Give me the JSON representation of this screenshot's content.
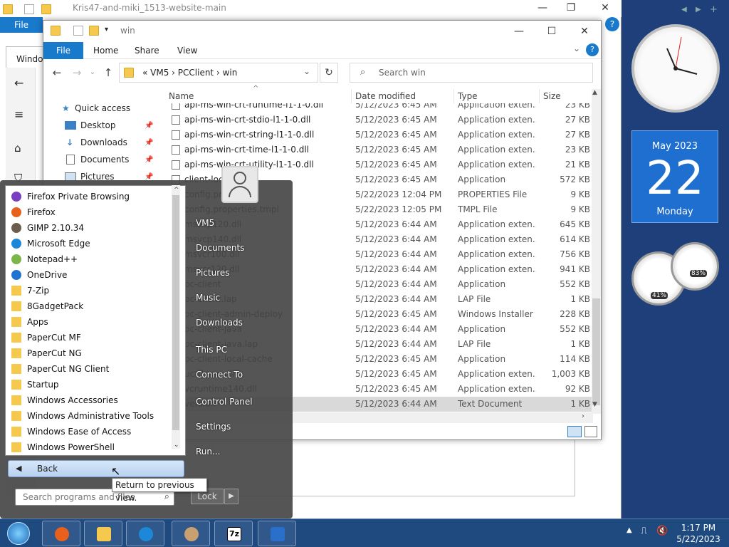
{
  "back_window": {
    "title": "Kris47-and-miki_1513-website-main",
    "file_tab": "File",
    "inner_title": "Windo"
  },
  "explorer": {
    "title": "win",
    "ribbon": {
      "file": "File",
      "home": "Home",
      "share": "Share",
      "view": "View"
    },
    "address": {
      "crumbs": "«   VM5   ›   PCClient   ›   win"
    },
    "search_placeholder": "Search win",
    "nav": [
      {
        "label": "Quick access",
        "pinned": false
      },
      {
        "label": "Desktop",
        "pinned": true
      },
      {
        "label": "Downloads",
        "pinned": true
      },
      {
        "label": "Documents",
        "pinned": true
      },
      {
        "label": "Pictures",
        "pinned": true
      }
    ],
    "columns": {
      "name": "Name",
      "date": "Date modified",
      "type": "Type",
      "size": "Size"
    },
    "files": [
      {
        "name": "api-ms-win-crt-runtime-l1-1-0.dll",
        "date": "5/12/2023 6:45 AM",
        "type": "Application exten...",
        "size": "23 KB"
      },
      {
        "name": "api-ms-win-crt-stdio-l1-1-0.dll",
        "date": "5/12/2023 6:45 AM",
        "type": "Application exten...",
        "size": "27 KB"
      },
      {
        "name": "api-ms-win-crt-string-l1-1-0.dll",
        "date": "5/12/2023 6:45 AM",
        "type": "Application exten...",
        "size": "27 KB"
      },
      {
        "name": "api-ms-win-crt-time-l1-1-0.dll",
        "date": "5/12/2023 6:45 AM",
        "type": "Application exten...",
        "size": "23 KB"
      },
      {
        "name": "api-ms-win-crt-utility-l1-1-0.dll",
        "date": "5/12/2023 6:45 AM",
        "type": "Application exten...",
        "size": "21 KB"
      },
      {
        "name": "client-local",
        "date": "5/12/2023 6:45 AM",
        "type": "Application",
        "size": "572 KB"
      },
      {
        "name": "config.properties",
        "date": "5/22/2023 12:04 PM",
        "type": "PROPERTIES File",
        "size": "9 KB"
      },
      {
        "name": "config.properties.tmpl",
        "date": "5/22/2023 12:05 PM",
        "type": "TMPL File",
        "size": "9 KB"
      },
      {
        "name": "msvcp120.dll",
        "date": "5/12/2023 6:44 AM",
        "type": "Application exten...",
        "size": "645 KB"
      },
      {
        "name": "msvcp140.dll",
        "date": "5/12/2023 6:44 AM",
        "type": "Application exten...",
        "size": "614 KB"
      },
      {
        "name": "msvcr100.dll",
        "date": "5/12/2023 6:44 AM",
        "type": "Application exten...",
        "size": "756 KB"
      },
      {
        "name": "msvcr120.dll",
        "date": "5/12/2023 6:44 AM",
        "type": "Application exten...",
        "size": "941 KB"
      },
      {
        "name": "pc-client",
        "date": "5/12/2023 6:44 AM",
        "type": "Application",
        "size": "552 KB"
      },
      {
        "name": "pc-client.lap",
        "date": "5/12/2023 6:44 AM",
        "type": "LAP File",
        "size": "1 KB"
      },
      {
        "name": "pc-client-admin-deploy",
        "date": "5/12/2023 6:45 AM",
        "type": "Windows Installer ...",
        "size": "228 KB"
      },
      {
        "name": "pc-client-java",
        "date": "5/12/2023 6:44 AM",
        "type": "Application",
        "size": "552 KB"
      },
      {
        "name": "pc-client-java.lap",
        "date": "5/12/2023 6:44 AM",
        "type": "LAP File",
        "size": "1 KB"
      },
      {
        "name": "pc-client-local-cache",
        "date": "5/12/2023 6:45 AM",
        "type": "Application",
        "size": "114 KB"
      },
      {
        "name": "ucrtbase.dll",
        "date": "5/12/2023 6:45 AM",
        "type": "Application exten...",
        "size": "1,003 KB"
      },
      {
        "name": "vcruntime140.dll",
        "date": "5/12/2023 6:45 AM",
        "type": "Application exten...",
        "size": "92 KB"
      },
      {
        "name": "version",
        "date": "5/12/2023 6:44 AM",
        "type": "Text Document",
        "size": "1 KB"
      }
    ]
  },
  "start_menu": {
    "programs": [
      {
        "label": "Firefox Private Browsing",
        "icon": "firefox-private-icon",
        "color": "#7a3fc0"
      },
      {
        "label": "Firefox",
        "icon": "firefox-icon",
        "color": "#e8601c"
      },
      {
        "label": "GIMP 2.10.34",
        "icon": "gimp-icon",
        "color": "#6b5e4e"
      },
      {
        "label": "Microsoft Edge",
        "icon": "edge-icon",
        "color": "#1e88d8"
      },
      {
        "label": "Notepad++",
        "icon": "notepadpp-icon",
        "color": "#7ab648"
      },
      {
        "label": "OneDrive",
        "icon": "onedrive-icon",
        "color": "#1e74d0"
      },
      {
        "label": "7-Zip",
        "icon": "folder-icon",
        "color": "#f4c94d"
      },
      {
        "label": "8GadgetPack",
        "icon": "folder-icon",
        "color": "#f4c94d"
      },
      {
        "label": "Apps",
        "icon": "apps-icon",
        "color": "#f4c94d"
      },
      {
        "label": "PaperCut MF",
        "icon": "folder-icon",
        "color": "#f4c94d"
      },
      {
        "label": "PaperCut NG",
        "icon": "folder-icon",
        "color": "#f4c94d"
      },
      {
        "label": "PaperCut NG Client",
        "icon": "folder-icon",
        "color": "#f4c94d"
      },
      {
        "label": "Startup",
        "icon": "folder-icon",
        "color": "#f4c94d"
      },
      {
        "label": "Windows Accessories",
        "icon": "folder-icon",
        "color": "#f4c94d"
      },
      {
        "label": "Windows Administrative Tools",
        "icon": "folder-icon",
        "color": "#f4c94d"
      },
      {
        "label": "Windows Ease of Access",
        "icon": "folder-icon",
        "color": "#f4c94d"
      },
      {
        "label": "Windows PowerShell",
        "icon": "folder-icon",
        "color": "#f4c94d"
      }
    ],
    "back_label": "Back",
    "search_placeholder": "Search programs and files",
    "right_links": [
      "VM5",
      "Documents",
      "Pictures",
      "Music",
      "Downloads",
      "This PC",
      "Connect To",
      "Control Panel",
      "Settings",
      "Run..."
    ],
    "lock_label": "Lock",
    "tooltip": "Return to previous view."
  },
  "gadgets": {
    "calendar_month": "May 2023",
    "calendar_day": "22",
    "calendar_weekday": "Monday",
    "cpu_percent": "41%",
    "mem_percent": "83%"
  },
  "taskbar": {
    "time": "1:17 PM",
    "date": "5/22/2023",
    "apps": [
      "firefox-icon",
      "file-explorer-icon",
      "edge-icon",
      "paint-icon",
      "7zip-icon",
      "defender-icon"
    ],
    "seven_zip_label": "7z"
  },
  "colors": {
    "accent": "#1979ca",
    "taskbar": "#1f4a80",
    "selection": "#d9d9d9"
  }
}
